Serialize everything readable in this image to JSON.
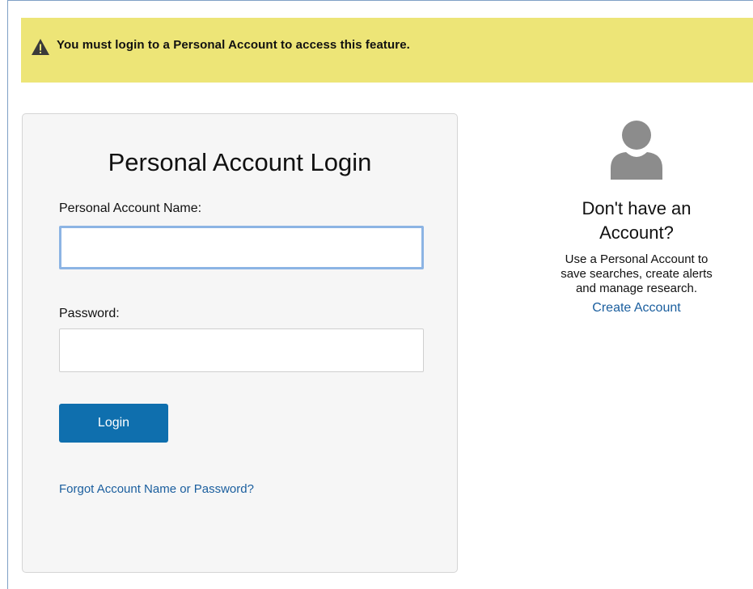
{
  "alert": {
    "icon": "warning-triangle-icon",
    "message": "You must login to a Personal Account to access this feature."
  },
  "login": {
    "title": "Personal Account Login",
    "account_name_label": "Personal Account Name:",
    "account_name_value": "",
    "password_label": "Password:",
    "password_value": "",
    "login_button": "Login",
    "forgot_link": "Forgot Account Name or Password?"
  },
  "signup": {
    "icon": "user-avatar-icon",
    "title_line1": "Don't have an",
    "title_line2": "Account?",
    "text_line1": "Use a Personal Account to",
    "text_line2": "save searches, create alerts",
    "text_line3": "and manage research.",
    "create_link": "Create Account"
  },
  "colors": {
    "alert_bg": "#ede577",
    "button_bg": "#0f6fae",
    "link": "#1a5e9e",
    "focus_border": "#8cb4e4",
    "icon_gray": "#8c8c8c"
  }
}
